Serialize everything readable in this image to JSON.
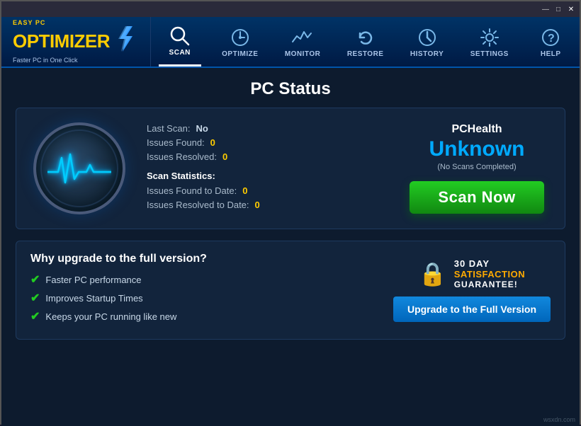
{
  "titlebar": {
    "minimize": "—",
    "maximize": "□",
    "close": "✕"
  },
  "header": {
    "logo_top": "EASY PC",
    "logo_main1": "OPTIMIZER",
    "logo_sub": "Faster PC in One Click",
    "nav": [
      {
        "id": "scan",
        "label": "SCAN",
        "active": true
      },
      {
        "id": "optimize",
        "label": "OPTIMIZE",
        "active": false
      },
      {
        "id": "monitor",
        "label": "MONITOR",
        "active": false
      },
      {
        "id": "restore",
        "label": "RESTORE",
        "active": false
      },
      {
        "id": "history",
        "label": "HISTORY",
        "active": false
      },
      {
        "id": "settings",
        "label": "SETTINGS",
        "active": false
      },
      {
        "id": "help",
        "label": "HELP",
        "active": false
      }
    ]
  },
  "main": {
    "page_title": "PC Status",
    "last_scan_label": "Last Scan:",
    "last_scan_value": "No",
    "issues_found_label": "Issues Found:",
    "issues_found_value": "0",
    "issues_resolved_label": "Issues Resolved:",
    "issues_resolved_value": "0",
    "scan_stats_title": "Scan Statistics:",
    "issues_to_date_label": "Issues Found to Date:",
    "issues_to_date_value": "0",
    "resolved_to_date_label": "Issues Resolved to Date:",
    "resolved_to_date_value": "0",
    "health_label": "PCHealth",
    "health_status": "Unknown",
    "health_sub": "(No Scans Completed)",
    "scan_now": "Scan Now"
  },
  "upgrade": {
    "title": "Why upgrade to the full version?",
    "features": [
      "Faster PC performance",
      "Improves Startup Times",
      "Keeps your PC running like new"
    ],
    "guarantee_days": "30 DAY",
    "guarantee_sat": "SATISFACTION",
    "guarantee_word": "GUARANTEE!",
    "upgrade_btn": "Upgrade to the Full Version"
  },
  "watermark": "wsxdn.com"
}
